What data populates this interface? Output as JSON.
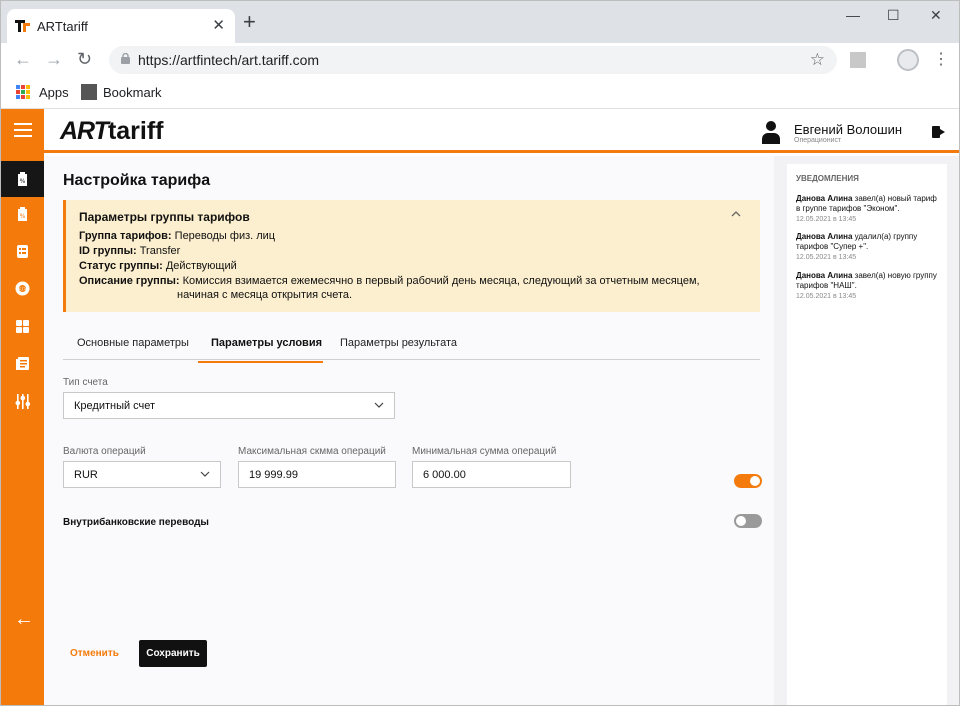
{
  "browser": {
    "tab_title": "ARTtariff",
    "url": "https://artfintech/art.tariff.com",
    "bookmarks": {
      "apps": "Apps",
      "bookmark": "Bookmark"
    }
  },
  "header": {
    "logo_art": "ART",
    "logo_tariff": "tariff",
    "user_name": "Евгений Волошин",
    "user_role": "Операционист"
  },
  "page": {
    "title": "Настройка тарифа",
    "info": {
      "title": "Параметры группы тарифов",
      "group_label": "Группа тарифов:",
      "group_value": "Переводы физ. лиц",
      "id_label": "ID группы:",
      "id_value": "Transfer",
      "status_label": "Статус группы:",
      "status_value": "Действующий",
      "desc_label": "Описание группы:",
      "desc_line1": "Комиссия взимается ежемесячно в первый рабочий день месяца, следующий за отчетным месяцем,",
      "desc_line2": "начиная с месяца открытия счета."
    },
    "tabs": [
      "Основные параметры",
      "Параметры условия",
      "Параметры результата"
    ],
    "active_tab": 1,
    "form": {
      "account_type_label": "Тип счета",
      "account_type_value": "Кредитный счет",
      "currency_label": "Валюта операций",
      "currency_value": "RUR",
      "max_label": "Максимальная скмма операций",
      "max_value": "19 999.99",
      "min_label": "Минимальная сумма операций",
      "min_value": "6 000.00",
      "amount_toggle": true,
      "intrabank_label": "Внутрибанковские переводы",
      "intrabank_toggle": false
    },
    "buttons": {
      "cancel": "Отменить",
      "save": "Сохранить"
    }
  },
  "notifications": {
    "title": "Уведомления",
    "items": [
      {
        "author": "Данова Алина",
        "text": " завел(а) новый тариф в группе тарифов \"Эконом\".",
        "time": "12.05.2021 в 13:45"
      },
      {
        "author": "Данова Алина",
        "text": " удалил(а) группу тарифов \"Супер +\".",
        "time": "12.05.2021 в 13:45"
      },
      {
        "author": "Данова Алина",
        "text": " завел(а) новую группу тарифов \"НАШ\".",
        "time": "12.05.2021 в 13:45"
      }
    ]
  },
  "colors": {
    "accent": "#f47b0b",
    "dark": "#161616",
    "info_bg": "#fcefcf"
  }
}
